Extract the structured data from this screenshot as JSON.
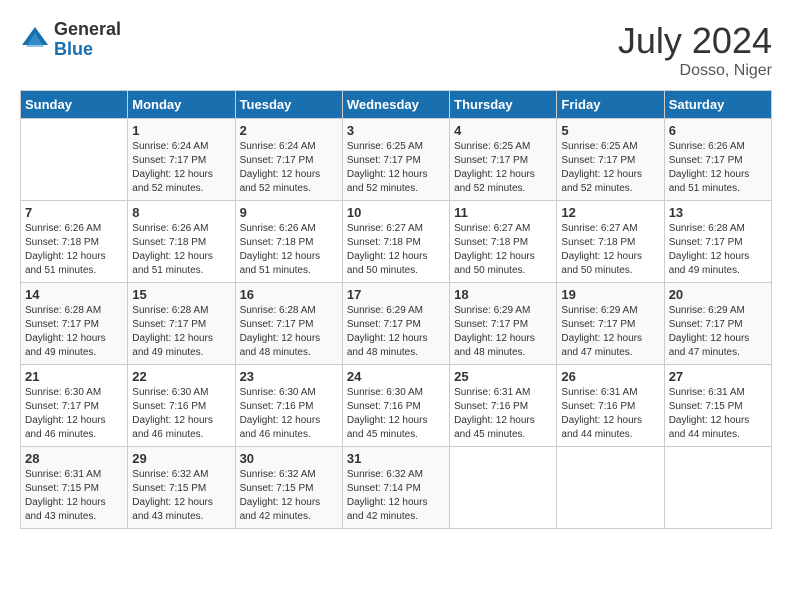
{
  "header": {
    "logo_general": "General",
    "logo_blue": "Blue",
    "month_year": "July 2024",
    "location": "Dosso, Niger"
  },
  "weekdays": [
    "Sunday",
    "Monday",
    "Tuesday",
    "Wednesday",
    "Thursday",
    "Friday",
    "Saturday"
  ],
  "weeks": [
    [
      {
        "day": "",
        "sunrise": "",
        "sunset": "",
        "daylight": ""
      },
      {
        "day": "1",
        "sunrise": "Sunrise: 6:24 AM",
        "sunset": "Sunset: 7:17 PM",
        "daylight": "Daylight: 12 hours and 52 minutes."
      },
      {
        "day": "2",
        "sunrise": "Sunrise: 6:24 AM",
        "sunset": "Sunset: 7:17 PM",
        "daylight": "Daylight: 12 hours and 52 minutes."
      },
      {
        "day": "3",
        "sunrise": "Sunrise: 6:25 AM",
        "sunset": "Sunset: 7:17 PM",
        "daylight": "Daylight: 12 hours and 52 minutes."
      },
      {
        "day": "4",
        "sunrise": "Sunrise: 6:25 AM",
        "sunset": "Sunset: 7:17 PM",
        "daylight": "Daylight: 12 hours and 52 minutes."
      },
      {
        "day": "5",
        "sunrise": "Sunrise: 6:25 AM",
        "sunset": "Sunset: 7:17 PM",
        "daylight": "Daylight: 12 hours and 52 minutes."
      },
      {
        "day": "6",
        "sunrise": "Sunrise: 6:26 AM",
        "sunset": "Sunset: 7:17 PM",
        "daylight": "Daylight: 12 hours and 51 minutes."
      }
    ],
    [
      {
        "day": "7",
        "sunrise": "Sunrise: 6:26 AM",
        "sunset": "Sunset: 7:18 PM",
        "daylight": "Daylight: 12 hours and 51 minutes."
      },
      {
        "day": "8",
        "sunrise": "Sunrise: 6:26 AM",
        "sunset": "Sunset: 7:18 PM",
        "daylight": "Daylight: 12 hours and 51 minutes."
      },
      {
        "day": "9",
        "sunrise": "Sunrise: 6:26 AM",
        "sunset": "Sunset: 7:18 PM",
        "daylight": "Daylight: 12 hours and 51 minutes."
      },
      {
        "day": "10",
        "sunrise": "Sunrise: 6:27 AM",
        "sunset": "Sunset: 7:18 PM",
        "daylight": "Daylight: 12 hours and 50 minutes."
      },
      {
        "day": "11",
        "sunrise": "Sunrise: 6:27 AM",
        "sunset": "Sunset: 7:18 PM",
        "daylight": "Daylight: 12 hours and 50 minutes."
      },
      {
        "day": "12",
        "sunrise": "Sunrise: 6:27 AM",
        "sunset": "Sunset: 7:18 PM",
        "daylight": "Daylight: 12 hours and 50 minutes."
      },
      {
        "day": "13",
        "sunrise": "Sunrise: 6:28 AM",
        "sunset": "Sunset: 7:17 PM",
        "daylight": "Daylight: 12 hours and 49 minutes."
      }
    ],
    [
      {
        "day": "14",
        "sunrise": "Sunrise: 6:28 AM",
        "sunset": "Sunset: 7:17 PM",
        "daylight": "Daylight: 12 hours and 49 minutes."
      },
      {
        "day": "15",
        "sunrise": "Sunrise: 6:28 AM",
        "sunset": "Sunset: 7:17 PM",
        "daylight": "Daylight: 12 hours and 49 minutes."
      },
      {
        "day": "16",
        "sunrise": "Sunrise: 6:28 AM",
        "sunset": "Sunset: 7:17 PM",
        "daylight": "Daylight: 12 hours and 48 minutes."
      },
      {
        "day": "17",
        "sunrise": "Sunrise: 6:29 AM",
        "sunset": "Sunset: 7:17 PM",
        "daylight": "Daylight: 12 hours and 48 minutes."
      },
      {
        "day": "18",
        "sunrise": "Sunrise: 6:29 AM",
        "sunset": "Sunset: 7:17 PM",
        "daylight": "Daylight: 12 hours and 48 minutes."
      },
      {
        "day": "19",
        "sunrise": "Sunrise: 6:29 AM",
        "sunset": "Sunset: 7:17 PM",
        "daylight": "Daylight: 12 hours and 47 minutes."
      },
      {
        "day": "20",
        "sunrise": "Sunrise: 6:29 AM",
        "sunset": "Sunset: 7:17 PM",
        "daylight": "Daylight: 12 hours and 47 minutes."
      }
    ],
    [
      {
        "day": "21",
        "sunrise": "Sunrise: 6:30 AM",
        "sunset": "Sunset: 7:17 PM",
        "daylight": "Daylight: 12 hours and 46 minutes."
      },
      {
        "day": "22",
        "sunrise": "Sunrise: 6:30 AM",
        "sunset": "Sunset: 7:16 PM",
        "daylight": "Daylight: 12 hours and 46 minutes."
      },
      {
        "day": "23",
        "sunrise": "Sunrise: 6:30 AM",
        "sunset": "Sunset: 7:16 PM",
        "daylight": "Daylight: 12 hours and 46 minutes."
      },
      {
        "day": "24",
        "sunrise": "Sunrise: 6:30 AM",
        "sunset": "Sunset: 7:16 PM",
        "daylight": "Daylight: 12 hours and 45 minutes."
      },
      {
        "day": "25",
        "sunrise": "Sunrise: 6:31 AM",
        "sunset": "Sunset: 7:16 PM",
        "daylight": "Daylight: 12 hours and 45 minutes."
      },
      {
        "day": "26",
        "sunrise": "Sunrise: 6:31 AM",
        "sunset": "Sunset: 7:16 PM",
        "daylight": "Daylight: 12 hours and 44 minutes."
      },
      {
        "day": "27",
        "sunrise": "Sunrise: 6:31 AM",
        "sunset": "Sunset: 7:15 PM",
        "daylight": "Daylight: 12 hours and 44 minutes."
      }
    ],
    [
      {
        "day": "28",
        "sunrise": "Sunrise: 6:31 AM",
        "sunset": "Sunset: 7:15 PM",
        "daylight": "Daylight: 12 hours and 43 minutes."
      },
      {
        "day": "29",
        "sunrise": "Sunrise: 6:32 AM",
        "sunset": "Sunset: 7:15 PM",
        "daylight": "Daylight: 12 hours and 43 minutes."
      },
      {
        "day": "30",
        "sunrise": "Sunrise: 6:32 AM",
        "sunset": "Sunset: 7:15 PM",
        "daylight": "Daylight: 12 hours and 42 minutes."
      },
      {
        "day": "31",
        "sunrise": "Sunrise: 6:32 AM",
        "sunset": "Sunset: 7:14 PM",
        "daylight": "Daylight: 12 hours and 42 minutes."
      },
      {
        "day": "",
        "sunrise": "",
        "sunset": "",
        "daylight": ""
      },
      {
        "day": "",
        "sunrise": "",
        "sunset": "",
        "daylight": ""
      },
      {
        "day": "",
        "sunrise": "",
        "sunset": "",
        "daylight": ""
      }
    ]
  ]
}
